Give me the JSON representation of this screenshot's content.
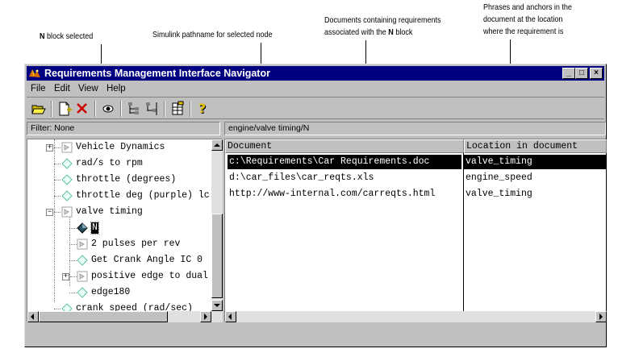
{
  "callouts": {
    "n_block": {
      "bold": "N",
      "rest": " block selected"
    },
    "pathname": {
      "text": "Simulink pathname for selected node"
    },
    "documents": {
      "line1": "Documents containing requirements",
      "line2_pre": "associated with the ",
      "line2_bold": "N",
      "line2_post": " block"
    },
    "anchors": {
      "line1": "Phrases and anchors in the",
      "line2": "document at the location",
      "line3": "where the requirement is"
    }
  },
  "window": {
    "title": "Requirements Management Interface Navigator",
    "minimize": "_",
    "maximize": "□",
    "close": "×"
  },
  "menu": [
    "File",
    "Edit",
    "View",
    "Help"
  ],
  "toolbar": {
    "buttons": [
      "open-folder-icon",
      "new-document-icon",
      "delete-icon",
      "view-eye-icon",
      "tree-expand-icon",
      "tree-collapse-icon",
      "grid-icon",
      "help-icon"
    ]
  },
  "filter_text": "Filter: None",
  "path_text": "engine/valve timing/N",
  "tree": [
    {
      "label": "Vehicle Dynamics",
      "level": 1,
      "expander": "+",
      "icon": "subsystem"
    },
    {
      "label": "rad/s to rpm",
      "level": 1,
      "icon": "block"
    },
    {
      "label": "throttle (degrees)",
      "level": 1,
      "icon": "block"
    },
    {
      "label": "throttle deg (purple) lc",
      "level": 1,
      "icon": "block"
    },
    {
      "label": "valve timing",
      "level": 1,
      "expander": "−",
      "icon": "subsystem"
    },
    {
      "label": "N",
      "level": 2,
      "icon": "block-selected",
      "selected": true
    },
    {
      "label": "2 pulses per rev",
      "level": 2,
      "icon": "subsystem"
    },
    {
      "label": "Get Crank Angle IC 0",
      "level": 2,
      "icon": "block"
    },
    {
      "label": "positive edge to dual",
      "level": 2,
      "expander": "+",
      "icon": "subsystem"
    },
    {
      "label": "edge180",
      "level": 2,
      "icon": "block"
    },
    {
      "label": "crank speed (rad/sec)",
      "level": 1,
      "icon": "block"
    }
  ],
  "table": {
    "headers": [
      "Document",
      "Location in document"
    ],
    "rows": [
      {
        "document": "c:\\Requirements\\Car Requirements.doc",
        "location": "valve_timing",
        "selected": true
      },
      {
        "document": "d:\\car_files\\car_reqts.xls",
        "location": "engine_speed"
      },
      {
        "document": "http://www-internal.com/carreqts.html",
        "location": "valve_timing"
      }
    ]
  },
  "colors": {
    "titlebar": "#000080",
    "face": "#c0c0c0",
    "selection": "#000000"
  }
}
